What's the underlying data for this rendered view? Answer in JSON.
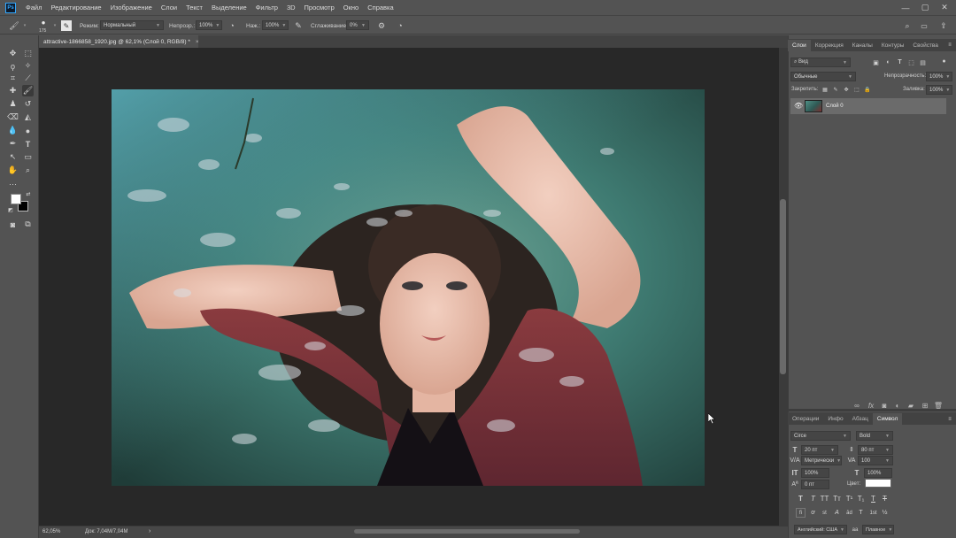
{
  "menu": {
    "logo": "Ps",
    "items": [
      "Файл",
      "Редактирование",
      "Изображение",
      "Слои",
      "Текст",
      "Выделение",
      "Фильтр",
      "3D",
      "Просмотр",
      "Окно",
      "Справка"
    ]
  },
  "options": {
    "brush_size": "175",
    "mode_label": "Режим:",
    "mode_value": "Нормальный",
    "opacity_label": "Непрозр.:",
    "opacity_value": "100%",
    "pressure_label": "Наж.:",
    "pressure_value": "100%",
    "smoothing_label": "Сглаживание:",
    "smoothing_value": "0%"
  },
  "document": {
    "tab_title": "attractive-1866858_1920.jpg @ 62,1% (Слой 0, RGB/8) *",
    "close": "×"
  },
  "status": {
    "zoom": "62,05%",
    "doc_size": "Док: 7,04M/7,04M",
    "arrow": "›"
  },
  "layers_panel": {
    "tabs": [
      "Слои",
      "Коррекция",
      "Каналы",
      "Контуры",
      "Свойства"
    ],
    "filter_value": "Вид",
    "blend_mode": "Обычные",
    "opacity_label": "Непрозрачность:",
    "opacity_value": "100%",
    "lock_label": "Закрепить:",
    "fill_label": "Заливка:",
    "fill_value": "100%",
    "layer_name": "Слой 0"
  },
  "character_panel": {
    "tabs": [
      "Операции",
      "Инфо",
      "Абзац",
      "Символ"
    ],
    "font_family": "Circe",
    "font_style": "Bold",
    "font_size": "20 пт",
    "leading": "80 пт",
    "kerning": "Метрически",
    "tracking": "100",
    "vertical_scale": "100%",
    "horizontal_scale": "100%",
    "baseline": "0 пт",
    "color_label": "Цвет:",
    "language": "Английский: США",
    "antialias": "Плавное",
    "aa_icon": "aa",
    "type_styles": [
      "T",
      "T",
      "TT",
      "Tт",
      "T¹",
      "T₁",
      "T",
      "T"
    ],
    "features": [
      "fi",
      "ơ",
      "st",
      "A",
      "ād",
      "T",
      "1st",
      "½"
    ]
  },
  "colors": {
    "accent": "#31a8ff",
    "foreground": "#ffffff",
    "background": "#000000",
    "text_color_swatch": "#ffffff"
  }
}
